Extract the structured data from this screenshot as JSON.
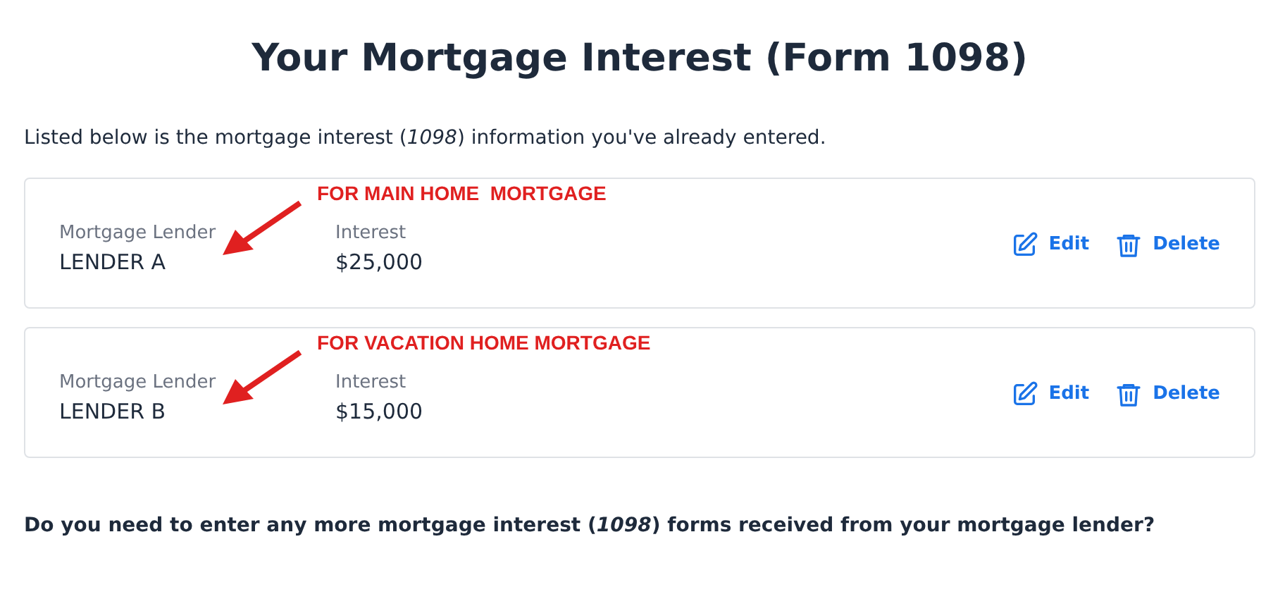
{
  "title": "Your Mortgage Interest (Form 1098)",
  "intro": "Listed below is the mortgage interest (*1098*) information you've already entered.",
  "entries": [
    {
      "annotation": "FOR MAIN HOME  MORTGAGE",
      "lender_label": "Mortgage Lender",
      "lender": "LENDER A",
      "interest_label": "Interest",
      "interest": "$25,000",
      "edit": "Edit",
      "delete": "Delete"
    },
    {
      "annotation": "FOR VACATION HOME MORTGAGE",
      "lender_label": "Mortgage Lender",
      "lender": "LENDER B",
      "interest_label": "Interest",
      "interest": "$15,000",
      "edit": "Edit",
      "delete": "Delete"
    }
  ],
  "question": "Do you need to enter any more mortgage interest (*1098*) forms received from your mortgage lender?"
}
